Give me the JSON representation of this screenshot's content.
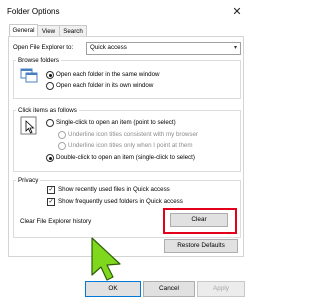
{
  "window": {
    "title": "Folder Options",
    "close_glyph": "✕"
  },
  "tabs": [
    {
      "label": "General",
      "active": true
    },
    {
      "label": "View",
      "active": false
    },
    {
      "label": "Search",
      "active": false
    }
  ],
  "open_with": {
    "label": "Open File Explorer to:",
    "value": "Quick access"
  },
  "browse_folders": {
    "title": "Browse folders",
    "options": [
      {
        "label": "Open each folder in the same window",
        "selected": true
      },
      {
        "label": "Open each folder in its own window",
        "selected": false
      }
    ]
  },
  "click_items": {
    "title": "Click items as follows",
    "single_click": "Single-click to open an item (point to select)",
    "underline_browser": "Underline icon titles consistent with my browser",
    "underline_point": "Underline icon titles only when I point at them",
    "double_click": "Double-click to open an item (single-click to select)"
  },
  "privacy": {
    "title": "Privacy",
    "recent_files": "Show recently used files in Quick access",
    "frequent_folders": "Show frequently used folders in Quick access",
    "clear_label": "Clear File Explorer history",
    "clear_button": "Clear",
    "check_glyph": "✓"
  },
  "restore_defaults": "Restore Defaults",
  "footer": {
    "ok": "OK",
    "cancel": "Cancel",
    "apply": "Apply"
  },
  "colors": {
    "highlight_box": "#e2001a",
    "cursor": "#7fd81e"
  },
  "icons": [
    "close-icon",
    "chevron-down-icon",
    "folder-window-icon",
    "pointer-icon",
    "cursor-arrow-icon"
  ]
}
